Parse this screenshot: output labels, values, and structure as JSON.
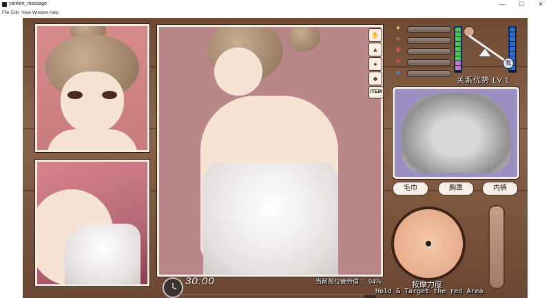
{
  "window": {
    "title": "yankee_massage",
    "minimize_glyph": "—",
    "maximize_glyph": "☐",
    "close_glyph": "✕"
  },
  "menu": {
    "items": [
      "File",
      "Edit",
      "View",
      "Window",
      "Help"
    ]
  },
  "tools": {
    "hand_icon": "hand-icon",
    "towel_icon": "towel-icon",
    "finger_icon": "finger-icon",
    "tool_icon": "tool-icon",
    "item_label": "ITEM"
  },
  "stats": {
    "icons": [
      "lightbulb-icon",
      "sparkle-icon",
      "cross-icon",
      "heart-icon",
      "thumbs-up-icon"
    ]
  },
  "relation": {
    "label": "关系优势 LV.1",
    "me_badge": "我"
  },
  "actions": {
    "towel": "毛巾",
    "bra": "胸罩",
    "panties": "内裤"
  },
  "timer": {
    "value": "30:00"
  },
  "fatigue": {
    "label": "当前部位疲劳值 ： 94%",
    "percent": 94
  },
  "massage": {
    "strength_label": "按摩力度",
    "hint": "Hold & Target the red Area"
  },
  "colors": {
    "gauge_green": "#46c85a",
    "gauge_blue": "#2f6fd0",
    "panel_border": "#f4ece2"
  }
}
